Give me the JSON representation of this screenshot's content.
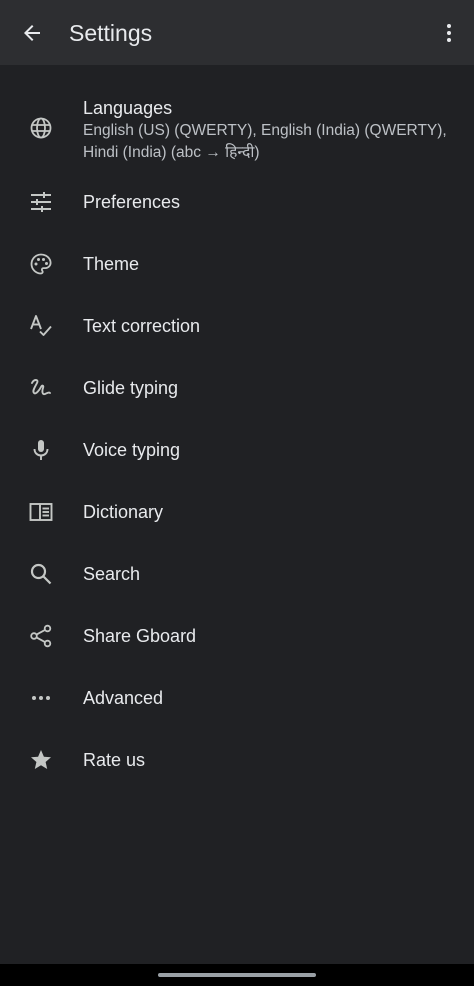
{
  "header": {
    "title": "Settings"
  },
  "languages": {
    "label": "Languages",
    "summary": "English (US) (QWERTY), English (India) (QWERTY), Hindi (India) (abc → हिन्दी)"
  },
  "items": [
    {
      "label": "Preferences",
      "icon": "sliders-icon"
    },
    {
      "label": "Theme",
      "icon": "palette-icon"
    },
    {
      "label": "Text correction",
      "icon": "spellcheck-icon"
    },
    {
      "label": "Glide typing",
      "icon": "gesture-icon"
    },
    {
      "label": "Voice typing",
      "icon": "microphone-icon"
    },
    {
      "label": "Dictionary",
      "icon": "book-icon"
    },
    {
      "label": "Search",
      "icon": "search-icon"
    },
    {
      "label": "Share Gboard",
      "icon": "share-icon"
    },
    {
      "label": "Advanced",
      "icon": "more-horizontal-icon"
    },
    {
      "label": "Rate us",
      "icon": "star-icon"
    }
  ],
  "colors": {
    "background": "#202124",
    "appbar": "#2d2e31",
    "text_primary": "#e8eaed",
    "text_secondary": "#bdc1c6",
    "icon": "#c4c7c5"
  }
}
